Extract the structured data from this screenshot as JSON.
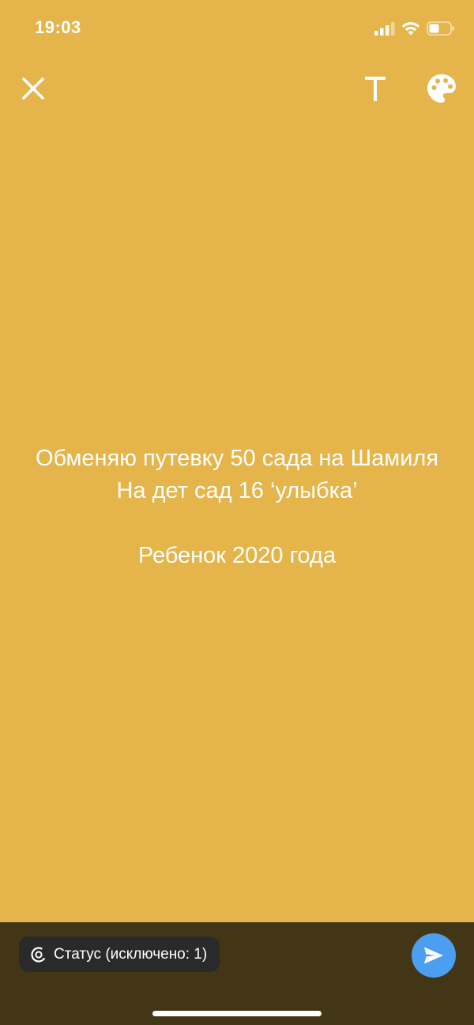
{
  "status_bar": {
    "time": "19:03"
  },
  "toolbar": {
    "close_icon": "close-icon",
    "text_icon": "text-format-icon",
    "palette_icon": "palette-icon"
  },
  "status_text": "Обменяю путевку 50 сада на Шамиля\nНа дет сад 16 ‘улыбка’\n\nРебенок 2020 года",
  "bottom_bar": {
    "privacy_label": "Статус (исключено: 1)",
    "send_icon": "send-icon"
  },
  "colors": {
    "background": "#E5B54B",
    "bottom_bar": "#433616",
    "send_button": "#4C9FF0"
  }
}
